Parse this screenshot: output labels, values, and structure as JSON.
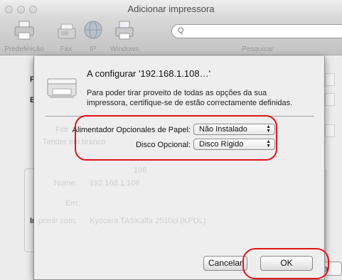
{
  "window": {
    "title": "Adicionar impressora"
  },
  "toolbar": {
    "items": [
      {
        "label": "Predefinição",
        "icon": "printer-icon"
      },
      {
        "label": "Fax",
        "icon": "fax-icon"
      },
      {
        "label": "IP",
        "icon": "globe-icon"
      },
      {
        "label": "Windows",
        "icon": "windows-printer-icon"
      }
    ],
    "search_placeholder": "Q",
    "search_label": "Pesquisar"
  },
  "background": {
    "fragment_labels": [
      "P",
      "E",
      "Filtr",
      "Nome:",
      "Em:",
      "Im",
      "primir com:"
    ],
    "address_value": "108",
    "name_value": "192.168.1.108",
    "driver_value": "Kyocera TASKalfa 2510ci (KPDL)",
    "faded_hint": "Tender em branco",
    "add_button_fragment": "a"
  },
  "sheet": {
    "title": "A configurar '192.168.1.108…'",
    "description": "Para poder tirar proveito de todas as opções da sua impressora, certifique-se de estão correctamente definidas.",
    "options": [
      {
        "label": "Alimentador Opcionales de Papel:",
        "value": "Não Instalado"
      },
      {
        "label": "Disco Opcional:",
        "value": "Disco Rígido"
      }
    ],
    "cancel_label": "Cancelar",
    "ok_label": "OK"
  },
  "colors": {
    "annotation_red": "#e01418",
    "window_bg": "#ececec",
    "sheet_bg": "#eeeeee"
  }
}
